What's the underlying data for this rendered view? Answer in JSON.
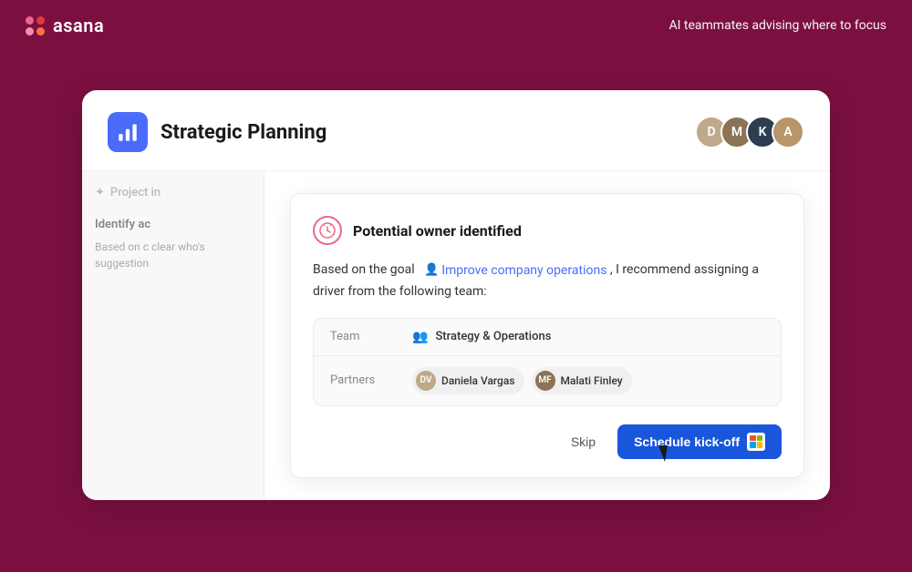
{
  "topBar": {
    "logoText": "asana",
    "tagline": "AI teammates advising where to focus"
  },
  "card": {
    "title": "Strategic Planning",
    "icon": "chart-icon"
  },
  "avatars": [
    {
      "id": "av1",
      "initials": "D"
    },
    {
      "id": "av2",
      "initials": "M"
    },
    {
      "id": "av3",
      "initials": "K"
    },
    {
      "id": "av4",
      "initials": "A"
    }
  ],
  "sidebar": {
    "sparkleLabel": "Project in",
    "sectionTitle": "Identify ac",
    "sectionText": "Based on c clear who's suggestion"
  },
  "aiPanel": {
    "headerTitle": "Potential owner identified",
    "bodyPre": "Based on the goal",
    "goalLink": "Improve company operations",
    "bodyPost": ", I recommend assigning a driver from the following team:",
    "table": {
      "rows": [
        {
          "label": "Team",
          "value": "Strategy & Operations"
        },
        {
          "label": "Partners",
          "partners": [
            {
              "name": "Daniela Vargas",
              "avatarClass": "pa1"
            },
            {
              "name": "Malati Finley",
              "avatarClass": "pa2"
            }
          ]
        }
      ]
    },
    "buttons": {
      "skip": "Skip",
      "schedule": "Schedule kick-off"
    }
  }
}
